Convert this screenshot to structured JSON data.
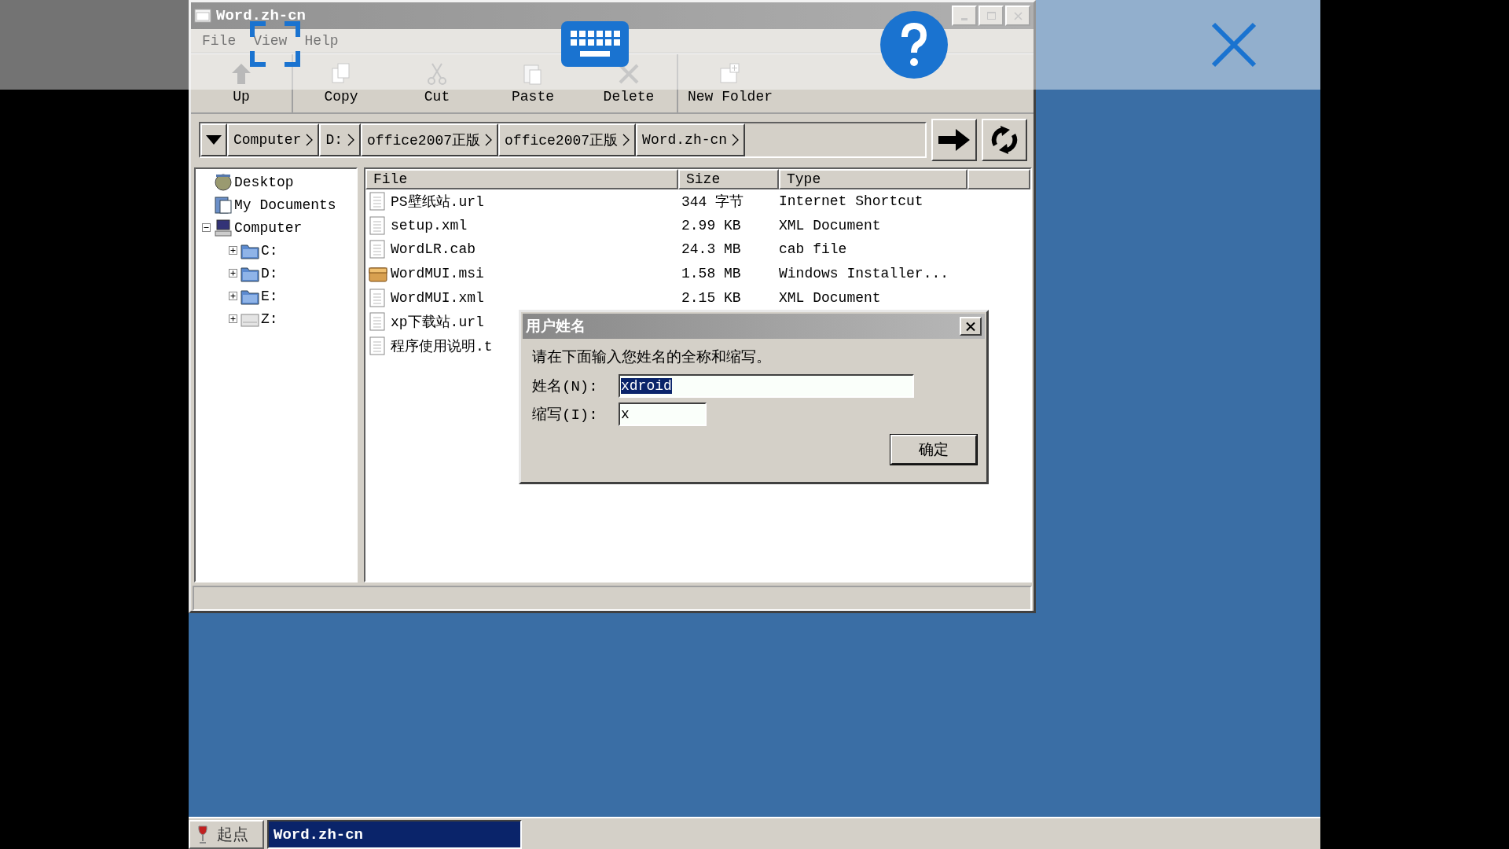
{
  "window": {
    "title": "Word.zh-cn",
    "active": false
  },
  "menu": [
    "File",
    "View",
    "Help"
  ],
  "toolbar": {
    "groups": [
      [
        {
          "label": "Up",
          "kind": "up"
        }
      ],
      [
        {
          "label": "Copy",
          "kind": "copy"
        },
        {
          "label": "Cut",
          "kind": "cut"
        },
        {
          "label": "Paste",
          "kind": "paste"
        },
        {
          "label": "Delete",
          "kind": "delete"
        }
      ],
      [
        {
          "label": "New Folder",
          "kind": "new-folder"
        }
      ]
    ]
  },
  "address_bar": {
    "crumbs": [
      "Computer",
      "D:",
      "office2007正版",
      "office2007正版",
      "Word.zh-cn"
    ]
  },
  "tree": [
    {
      "label": "Desktop",
      "kind": "desktop"
    },
    {
      "label": "My Documents",
      "kind": "documents"
    },
    {
      "label": "Computer",
      "kind": "computer",
      "expanded": true,
      "children": [
        {
          "label": "C:",
          "kind": "drive",
          "expanded": false
        },
        {
          "label": "D:",
          "kind": "drive",
          "expanded": false
        },
        {
          "label": "E:",
          "kind": "drive",
          "expanded": false
        },
        {
          "label": "Z:",
          "kind": "network-drive",
          "expanded": false
        }
      ]
    }
  ],
  "file_list": {
    "columns": [
      "File",
      "Size",
      "Type"
    ],
    "rows": [
      {
        "name": "PS壁纸站.url",
        "size": "344 字节",
        "type": "Internet Shortcut",
        "kind": "document"
      },
      {
        "name": "setup.xml",
        "size": "2.99 KB",
        "type": "XML Document",
        "kind": "document"
      },
      {
        "name": "WordLR.cab",
        "size": "24.3 MB",
        "type": "cab file",
        "kind": "document"
      },
      {
        "name": "WordMUI.msi",
        "size": "1.58 MB",
        "type": "Windows Installer...",
        "kind": "installer"
      },
      {
        "name": "WordMUI.xml",
        "size": "2.15 KB",
        "type": "XML Document",
        "kind": "document"
      },
      {
        "name": "xp下载站.url",
        "kind": "document"
      },
      {
        "name": "程序使用说明.t",
        "kind": "document"
      }
    ]
  },
  "dialog": {
    "title": "用户姓名",
    "message": "请在下面输入您姓名的全称和缩写。",
    "fields": [
      {
        "label": "姓名(N):",
        "value": "xdroid",
        "text_selected": true,
        "kind": "long"
      },
      {
        "label": "缩写(I):",
        "value": "x",
        "text_selected": false,
        "kind": "short"
      }
    ],
    "button": "确定"
  },
  "taskbar": {
    "start": "起点",
    "tasks": [
      {
        "label": "Word.zh-cn",
        "selected": true
      }
    ]
  }
}
